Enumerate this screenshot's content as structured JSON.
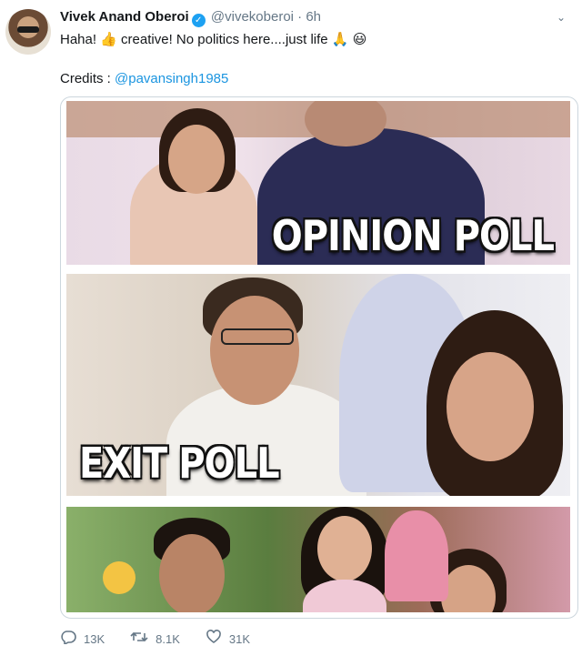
{
  "author": {
    "name": "Vivek Anand Oberoi",
    "handle": "@vivekoberoi",
    "separator": "·",
    "time": "6h",
    "verified_icon": "verified-badge-icon"
  },
  "tweet": {
    "text_before": "Haha! ",
    "text_mid": " creative! No politics here....just life ",
    "emoji_1": "👍",
    "emoji_2": "🙏",
    "emoji_3": "😃",
    "credits_label": "Credits : ",
    "credits_mention": "@pavansingh1985"
  },
  "media": {
    "panel_1_caption": "OPINION POLL",
    "panel_2_caption": "EXIT POLL"
  },
  "actions": {
    "reply_count": "13K",
    "retweet_count": "8.1K",
    "like_count": "31K"
  },
  "colors": {
    "link": "#1b95e0",
    "verified": "#1da1f2",
    "muted": "#657786"
  }
}
